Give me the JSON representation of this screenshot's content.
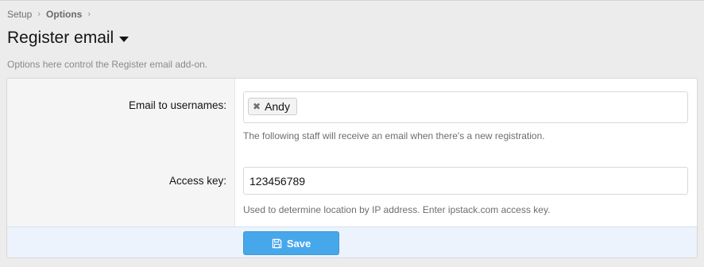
{
  "breadcrumb": {
    "items": [
      {
        "label": "Setup"
      },
      {
        "label": "Options"
      }
    ],
    "separator": "›"
  },
  "page": {
    "title": "Register email",
    "description": "Options here control the Register email add-on."
  },
  "form": {
    "email_usernames": {
      "label": "Email to usernames:",
      "tokens": [
        "Andy"
      ],
      "remove_glyph": "✖",
      "explain": "The following staff will receive an email when there's a new registration."
    },
    "access_key": {
      "label": "Access key:",
      "value": "123456789",
      "explain": "Used to determine location by IP address. Enter ipstack.com access key."
    },
    "save_label": "Save"
  },
  "colors": {
    "primary_button": "#47a7eb",
    "submit_row": "#edf3fc"
  },
  "icons": {
    "title_menu": "caret-down-icon",
    "token_remove": "x-icon",
    "save": "floppy-disk-icon"
  }
}
